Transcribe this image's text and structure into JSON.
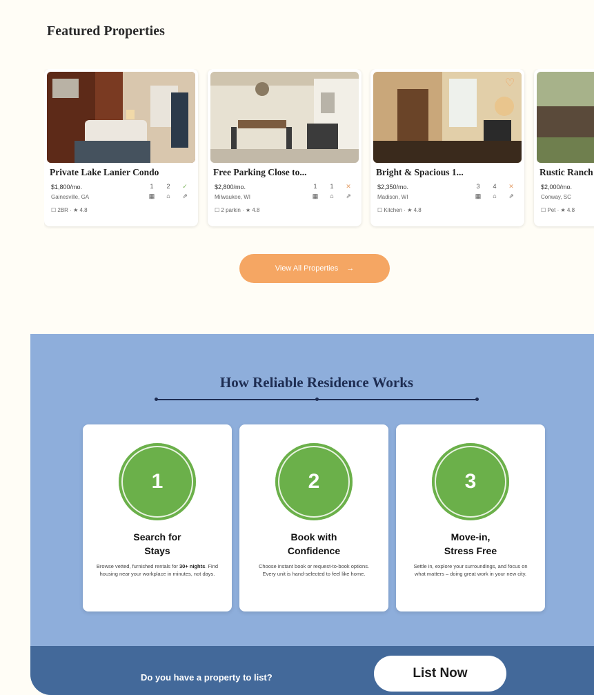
{
  "featured": {
    "title": "Featured Properties",
    "view_all_label": "View All Properties",
    "view_all_arrow": "→",
    "cards": [
      {
        "title": "Private Lake Lanier Condo",
        "price": "$1,800/mo.",
        "location": "Gainesville, GA",
        "meta": "☐ 2BR · ★ 4.8",
        "stats_top": [
          "1",
          "2",
          "✓"
        ],
        "stats_bottom": [
          "▦",
          "⌂",
          "⇗"
        ],
        "favorite": false,
        "palette": [
          "#7a3a22",
          "#d9c7ae",
          "#e9e4db",
          "#2c3a4a"
        ]
      },
      {
        "title": "Free Parking Close to...",
        "price": "$2,800/mo.",
        "location": "Milwaukee, WI",
        "meta": "☐ 2 parkin · ★ 4.8",
        "stats_top": [
          "1",
          "1",
          "✕"
        ],
        "stats_bottom": [
          "▦",
          "⌂",
          "⇗"
        ],
        "favorite": false,
        "palette": [
          "#cfc4ae",
          "#e7e1d2",
          "#7b5b3f",
          "#3b3b3b"
        ]
      },
      {
        "title": "Bright & Spacious 1...",
        "price": "$2,350/mo.",
        "location": "Madison, WI",
        "meta": "☐ Kitchen · ★ 4.8",
        "stats_top": [
          "3",
          "4",
          "✕"
        ],
        "stats_bottom": [
          "▦",
          "⌂",
          "⇗"
        ],
        "favorite": true,
        "palette": [
          "#6a4428",
          "#c9a77a",
          "#3a2a1c",
          "#e9c58d"
        ]
      },
      {
        "title": "Rustic Ranch",
        "price": "$2,000/mo.",
        "location": "Conway, SC",
        "meta": "☐ Pet · ★ 4.8",
        "stats_top": [
          "",
          "",
          ""
        ],
        "stats_bottom": [
          "",
          "",
          ""
        ],
        "favorite": false,
        "palette": [
          "#6f7f4e",
          "#a7b28a",
          "#5a4a3a",
          "#c9d1c2"
        ]
      }
    ]
  },
  "how": {
    "title": "How Reliable Residence Works",
    "steps": [
      {
        "number": "1",
        "title_line1": "Search for",
        "title_line2": "Stays",
        "desc_pre": "Browse vetted, furnished rentals for",
        "desc_bold": "30+ nights",
        "desc_post": ". Find housing near your workplace in minutes, not days."
      },
      {
        "number": "2",
        "title_line1": "Book with",
        "title_line2": "Confidence",
        "desc_pre": "Choose instant book or request-to-book options. Every unit is hand-selected to feel like home.",
        "desc_bold": "",
        "desc_post": ""
      },
      {
        "number": "3",
        "title_line1": "Move-in,",
        "title_line2": "Stress Free",
        "desc_pre": "Settle in, explore your surroundings, and focus on what matters – doing great work in your new city.",
        "desc_bold": "",
        "desc_post": ""
      }
    ]
  },
  "cta": {
    "question": "Do you have a property to list?",
    "button_label": "List Now"
  },
  "colors": {
    "accent_orange": "#f5a663",
    "section_blue": "#8eaedb",
    "bar_blue": "#43699a",
    "step_green": "#6bb04a",
    "heading_navy": "#1e2d52"
  }
}
